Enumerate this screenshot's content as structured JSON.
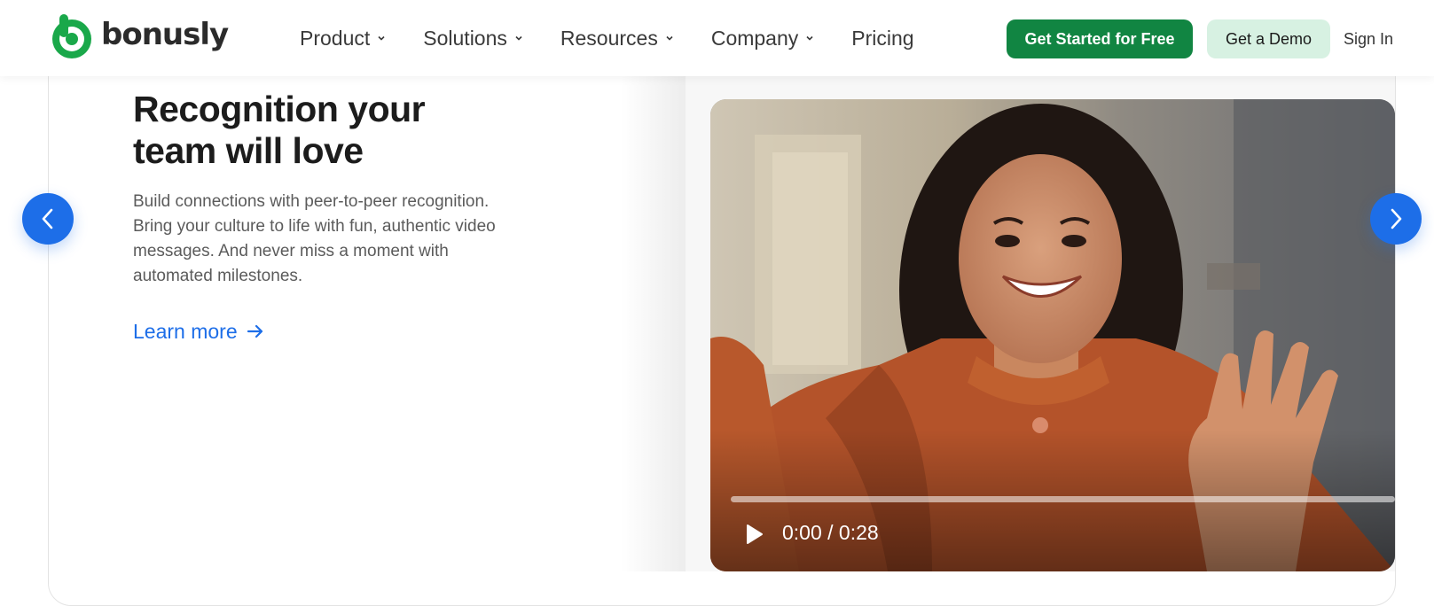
{
  "brand": {
    "name": "bonusly",
    "logo_icon": "bonusly-b-logo-icon",
    "color": "#1aa84a"
  },
  "nav": {
    "links": [
      {
        "label": "Product",
        "has_dropdown": true
      },
      {
        "label": "Solutions",
        "has_dropdown": true
      },
      {
        "label": "Resources",
        "has_dropdown": true
      },
      {
        "label": "Company",
        "has_dropdown": true
      },
      {
        "label": "Pricing",
        "has_dropdown": false
      }
    ],
    "cta_primary": "Get Started for Free",
    "cta_secondary": "Get a Demo",
    "sign_in": "Sign In"
  },
  "slide": {
    "headline": "Recognition your team will love",
    "description": "Build connections with peer-to-peer recognition. Bring your culture to life with fun, authentic video messages. And never miss a moment with automated milestones.",
    "learn_more": "Learn more",
    "link_color": "#1d6ee8"
  },
  "video": {
    "time": "0:00 / 0:28",
    "progress": 0,
    "play_icon": "play-icon"
  },
  "carousel": {
    "prev_icon": "chevron-left-icon",
    "next_icon": "chevron-right-icon",
    "accent": "#1d6ee8"
  },
  "colors": {
    "primary_button": "#118542",
    "secondary_button": "#d7f1e2"
  }
}
